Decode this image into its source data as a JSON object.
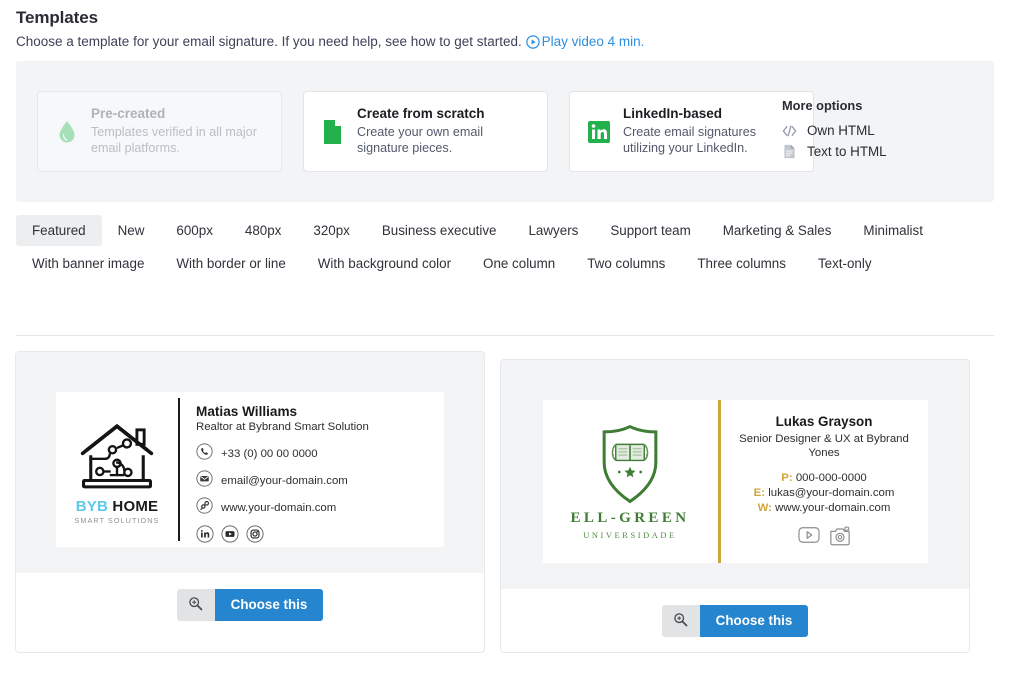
{
  "header": {
    "title": "Templates",
    "subtitle": "Choose a template for your email signature. If you need help, see how to get started.",
    "play_link": "Play video 4 min.",
    "play_icon": "play-circle-icon"
  },
  "options": {
    "cards": [
      {
        "title": "Pre-created",
        "desc": "Templates verified in all major email platforms.",
        "icon": "drop-icon",
        "disabled": true
      },
      {
        "title": "Create from scratch",
        "desc": "Create your own email signature pieces.",
        "icon": "document-green-icon",
        "disabled": false
      },
      {
        "title": "LinkedIn-based",
        "desc": "Create email signatures utilizing your LinkedIn.",
        "icon": "linkedin-icon",
        "disabled": false
      }
    ],
    "more_title": "More options",
    "more_items": [
      {
        "label": "Own HTML",
        "icon": "code-icon"
      },
      {
        "label": "Text to HTML",
        "icon": "file-text-icon"
      }
    ]
  },
  "filters": {
    "active": "Featured",
    "tabs": [
      "Featured",
      "New",
      "600px",
      "480px",
      "320px",
      "Business executive",
      "Lawyers",
      "Support team",
      "Marketing & Sales",
      "Minimalist",
      "With banner image",
      "With border or line",
      "With background color",
      "One column",
      "Two columns",
      "Three columns",
      "Text-only"
    ]
  },
  "templates": [
    {
      "zoom_icon": "magnifier-plus-icon",
      "choose_label": "Choose this",
      "signature": {
        "logo": {
          "icon": "house-circuit-logo",
          "word_a": "BYB",
          "word_b": " HOME",
          "tagline": "SMART SOLUTIONS"
        },
        "name": "Matias Williams",
        "role": "Realtor at Bybrand Smart Solution",
        "contacts": [
          {
            "icon": "phone-icon",
            "text": "+33 (0) 00 00 0000"
          },
          {
            "icon": "envelope-icon",
            "text": "email@your-domain.com"
          },
          {
            "icon": "link-icon",
            "text": "www.your-domain.com"
          }
        ],
        "social": [
          "linkedin-icon",
          "youtube-icon",
          "instagram-icon"
        ]
      }
    },
    {
      "zoom_icon": "magnifier-plus-icon",
      "choose_label": "Choose this",
      "signature": {
        "logo": {
          "icon": "shield-book-logo",
          "word": "ELL-GREEN",
          "tagline": "UNIVERSIDADE"
        },
        "name": "Lukas Grayson",
        "role": "Senior Designer & UX at Bybrand Yones",
        "contacts": [
          {
            "key": "P:",
            "text": "000-000-0000"
          },
          {
            "key": "E:",
            "text": "lukas@your-domain.com"
          },
          {
            "key": "W:",
            "text": "www.your-domain.com"
          }
        ],
        "social": [
          "youtube-icon",
          "instagram-icon"
        ]
      }
    }
  ],
  "colors": {
    "accent_blue": "#2585ce",
    "link_blue": "#2d8fe0",
    "panel_grey": "#f3f4f6",
    "byb_blue": "#5ec8e8",
    "ell_green": "#3f7d35",
    "gold": "#d2a43a"
  }
}
